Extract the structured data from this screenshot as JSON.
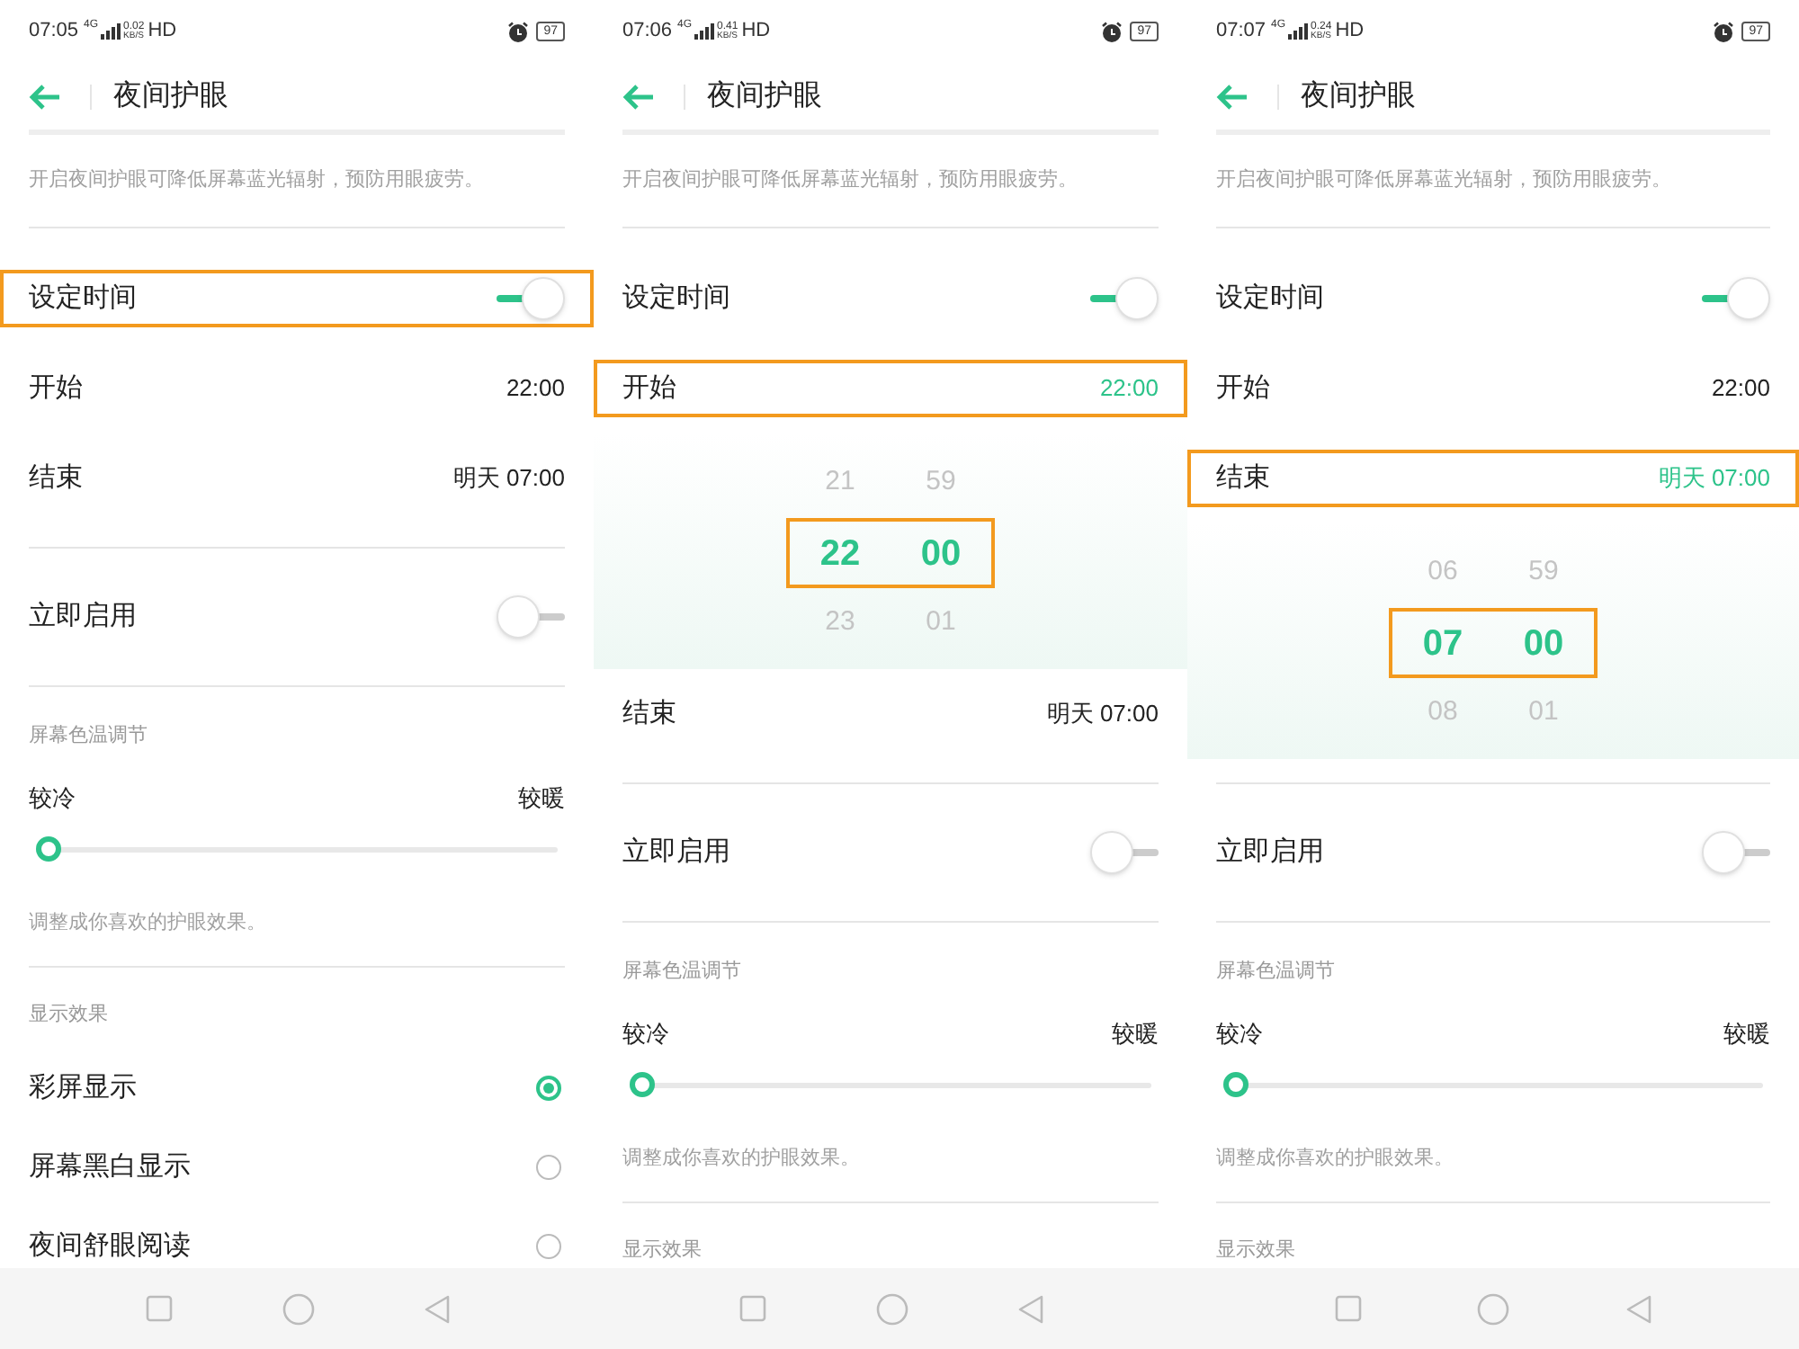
{
  "screens": [
    {
      "status": {
        "time": "07:05",
        "network": "4G",
        "speed": "0.02",
        "speed_unit": "KB/S",
        "hd": "HD",
        "battery": "97"
      },
      "title": "夜间护眼",
      "description": "开启夜间护眼可降低屏幕蓝光辐射，预防用眼疲劳。",
      "rows": [
        {
          "kind": "toggle",
          "label": "设定时间",
          "on": true,
          "highlighted": true
        },
        {
          "kind": "time",
          "label": "开始",
          "value": "22:00",
          "active": false,
          "highlighted": false
        },
        {
          "kind": "time",
          "label": "结束",
          "value": "明天 07:00",
          "active": false,
          "highlighted": false
        },
        {
          "kind": "divider"
        },
        {
          "kind": "toggle",
          "label": "立即启用",
          "on": false,
          "highlighted": false
        },
        {
          "kind": "divider"
        },
        {
          "kind": "header",
          "label": "屏幕色温调节"
        },
        {
          "kind": "slider",
          "left": "较冷",
          "right": "较暖",
          "level": 0
        },
        {
          "kind": "note",
          "text": "调整成你喜欢的护眼效果。"
        },
        {
          "kind": "divider"
        },
        {
          "kind": "header",
          "label": "显示效果"
        },
        {
          "kind": "radio",
          "label": "彩屏显示",
          "selected": true
        },
        {
          "kind": "radio",
          "label": "屏幕黑白显示",
          "selected": false
        },
        {
          "kind": "radio",
          "label": "夜间舒眼阅读",
          "selected": false
        }
      ]
    },
    {
      "status": {
        "time": "07:06",
        "network": "4G",
        "speed": "0.41",
        "speed_unit": "KB/S",
        "hd": "HD",
        "battery": "97"
      },
      "title": "夜间护眼",
      "description": "开启夜间护眼可降低屏幕蓝光辐射，预防用眼疲劳。",
      "rows": [
        {
          "kind": "toggle",
          "label": "设定时间",
          "on": true,
          "highlighted": false
        },
        {
          "kind": "time",
          "label": "开始",
          "value": "22:00",
          "active": true,
          "highlighted": true
        },
        {
          "kind": "picker",
          "highlighted": true,
          "hours": [
            "21",
            "22",
            "23"
          ],
          "minutes": [
            "59",
            "00",
            "01"
          ]
        },
        {
          "kind": "time",
          "label": "结束",
          "value": "明天 07:00",
          "active": false,
          "highlighted": false
        },
        {
          "kind": "divider"
        },
        {
          "kind": "toggle",
          "label": "立即启用",
          "on": false,
          "highlighted": false
        },
        {
          "kind": "divider"
        },
        {
          "kind": "header",
          "label": "屏幕色温调节"
        },
        {
          "kind": "slider",
          "left": "较冷",
          "right": "较暖",
          "level": 0
        },
        {
          "kind": "note",
          "text": "调整成你喜欢的护眼效果。"
        },
        {
          "kind": "divider"
        },
        {
          "kind": "header",
          "label": "显示效果"
        }
      ]
    },
    {
      "status": {
        "time": "07:07",
        "network": "4G",
        "speed": "0.24",
        "speed_unit": "KB/S",
        "hd": "HD",
        "battery": "97"
      },
      "title": "夜间护眼",
      "description": "开启夜间护眼可降低屏幕蓝光辐射，预防用眼疲劳。",
      "rows": [
        {
          "kind": "toggle",
          "label": "设定时间",
          "on": true,
          "highlighted": false
        },
        {
          "kind": "time",
          "label": "开始",
          "value": "22:00",
          "active": false,
          "highlighted": false
        },
        {
          "kind": "time",
          "label": "结束",
          "value": "明天 07:00",
          "active": true,
          "highlighted": true
        },
        {
          "kind": "picker",
          "highlighted": true,
          "hours": [
            "06",
            "07",
            "08"
          ],
          "minutes": [
            "59",
            "00",
            "01"
          ]
        },
        {
          "kind": "divider"
        },
        {
          "kind": "toggle",
          "label": "立即启用",
          "on": false,
          "highlighted": false
        },
        {
          "kind": "divider"
        },
        {
          "kind": "header",
          "label": "屏幕色温调节"
        },
        {
          "kind": "slider",
          "left": "较冷",
          "right": "较暖",
          "level": 0
        },
        {
          "kind": "note",
          "text": "调整成你喜欢的护眼效果。"
        },
        {
          "kind": "divider"
        },
        {
          "kind": "header",
          "label": "显示效果"
        }
      ]
    }
  ]
}
